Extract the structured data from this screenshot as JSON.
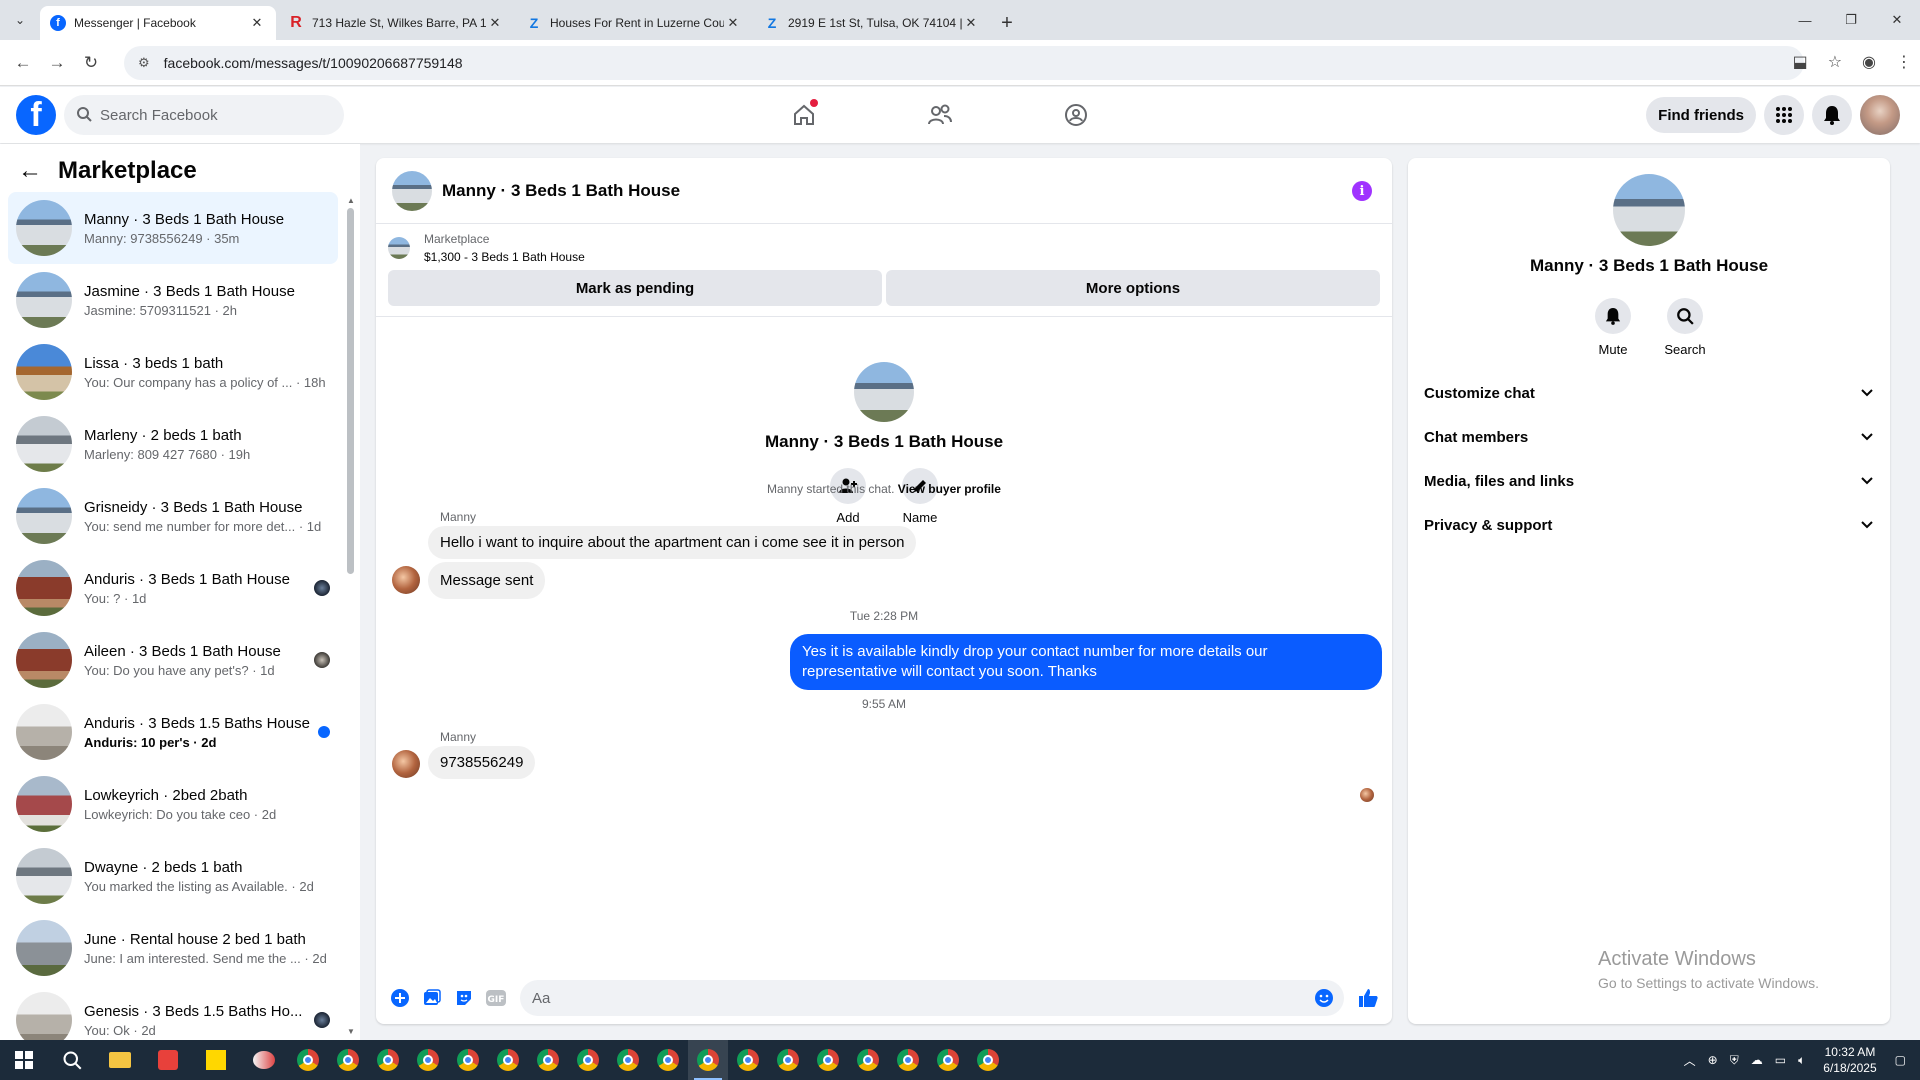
{
  "browser": {
    "tabs": [
      {
        "title": "Messenger | Facebook",
        "favicon": "facebook-icon",
        "color": "#0866ff",
        "active": true
      },
      {
        "title": "713 Hazle St, Wilkes Barre, PA 1",
        "favicon": "realtor-icon",
        "color": "#d92228",
        "active": false
      },
      {
        "title": "Houses For Rent in Luzerne Cou",
        "favicon": "zillow-icon",
        "color": "#1277e1",
        "active": false
      },
      {
        "title": "2919 E 1st St, Tulsa, OK 74104 |",
        "favicon": "zillow-icon",
        "color": "#1277e1",
        "active": false
      }
    ],
    "url": "facebook.com/messages/t/10090206687759148"
  },
  "fbnav": {
    "search_placeholder": "Search Facebook",
    "find_friends": "Find friends"
  },
  "sidebar": {
    "title": "Marketplace",
    "conversations": [
      {
        "name": "Manny · 3 Beds 1 Bath House",
        "snippet": "Manny: 9738556249 · 35m",
        "thumb": "house",
        "active": true,
        "badge": "none",
        "unread": false
      },
      {
        "name": "Jasmine · 3 Beds 1 Bath House",
        "snippet": "Jasmine: 5709311521 · 2h",
        "thumb": "house",
        "active": false,
        "badge": "none",
        "unread": false
      },
      {
        "name": "Lissa · 3 beds 1 bath",
        "snippet": "You: Our company has a policy of ... · 18h",
        "thumb": "house2",
        "active": false,
        "badge": "none",
        "unread": false
      },
      {
        "name": "Marleny · 2 beds 1 bath",
        "snippet": "Marleny: 809 427 7680 · 19h",
        "thumb": "house3",
        "active": false,
        "badge": "none",
        "unread": false
      },
      {
        "name": "Grisneidy · 3 Beds 1 Bath House",
        "snippet": "You: send me number for more det... · 1d",
        "thumb": "house",
        "active": false,
        "badge": "none",
        "unread": false
      },
      {
        "name": "Anduris · 3 Beds 1 Bath House",
        "snippet": "You: ? · 1d",
        "thumb": "house4",
        "active": false,
        "badge": "avatar",
        "unread": false
      },
      {
        "name": "Aileen · 3 Beds 1 Bath House",
        "snippet": "You: Do you have any pet's? · 1d",
        "thumb": "house4",
        "active": false,
        "badge": "avatar2",
        "unread": false
      },
      {
        "name": "Anduris · 3 Beds 1.5 Baths House",
        "snippet": "Anduris: 10 per's · 2d",
        "thumb": "house5",
        "active": false,
        "badge": "dot",
        "unread": true
      },
      {
        "name": "Lowkeyrich · 2bed 2bath",
        "snippet": "Lowkeyrich: Do you take ceo · 2d",
        "thumb": "house6",
        "active": false,
        "badge": "none",
        "unread": false
      },
      {
        "name": "Dwayne · 2 beds 1 bath",
        "snippet": "You marked the listing as Available. · 2d",
        "thumb": "house3",
        "active": false,
        "badge": "none",
        "unread": false
      },
      {
        "name": "June · Rental house 2 bed 1 bath",
        "snippet": "June: I am interested. Send me the ... · 2d",
        "thumb": "house7",
        "active": false,
        "badge": "none",
        "unread": false
      },
      {
        "name": "Genesis · 3 Beds 1.5 Baths Ho...",
        "snippet": "You: Ok · 2d",
        "thumb": "house5",
        "active": false,
        "badge": "avatar",
        "unread": false
      }
    ]
  },
  "chat": {
    "title": "Manny · 3 Beds 1 Bath House",
    "marketplace_label": "Marketplace",
    "listing": "$1,300 - 3 Beds 1 Bath House",
    "btn_pending": "Mark as pending",
    "btn_more": "More options",
    "profile_name": "Manny · 3 Beds 1 Bath House",
    "add_label": "Add",
    "name_label": "Name",
    "started_text": "Manny started this chat.",
    "view_profile": "View buyer profile",
    "sender": "Manny",
    "msg1": "Hello i want to inquire about the apartment can i come see it in person",
    "msg2": "Message sent",
    "time1": "Tue 2:28 PM",
    "msg3_line1": "Yes it is available kindly drop your contact number for more details our",
    "msg3_line2": "representative will contact you soon. Thanks",
    "time2": "9:55 AM",
    "msg4": "9738556249",
    "composer_placeholder": "Aa"
  },
  "rpanel": {
    "name": "Manny · 3 Beds 1 Bath House",
    "mute": "Mute",
    "search": "Search",
    "menu": [
      "Customize chat",
      "Chat members",
      "Media, files and links",
      "Privacy & support"
    ]
  },
  "watermark": {
    "line1": "Activate Windows",
    "line2": "Go to Settings to activate Windows."
  },
  "taskbar": {
    "time": "10:32 AM",
    "date": "6/18/2025"
  },
  "colors": {
    "fb_blue": "#0866ff",
    "outgoing_bubble": "#0a5cff",
    "info_purple": "#a033ff"
  }
}
